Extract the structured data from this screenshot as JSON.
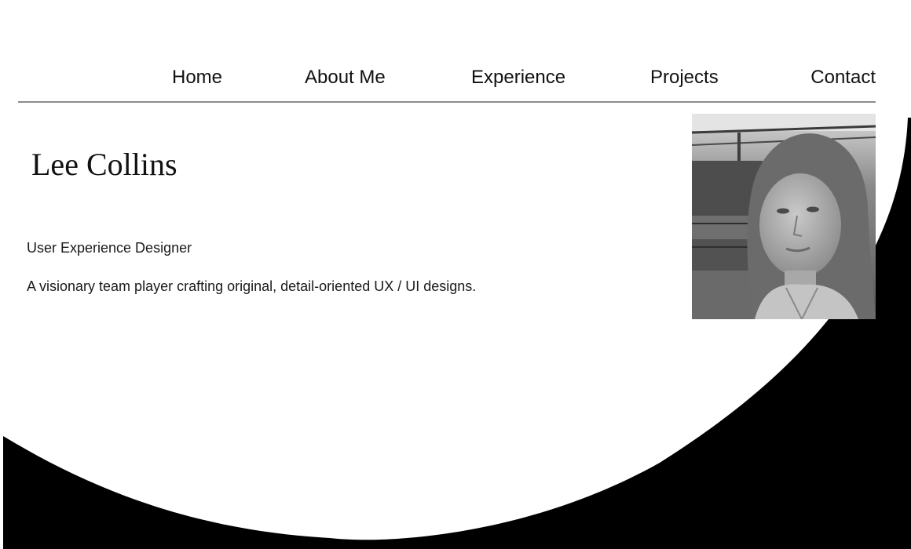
{
  "nav": {
    "items": [
      {
        "label": "Home"
      },
      {
        "label": "About Me"
      },
      {
        "label": "Experience"
      },
      {
        "label": "Projects"
      },
      {
        "label": "Contact"
      }
    ]
  },
  "hero": {
    "name": "Lee Collins",
    "role": "User Experience Designer",
    "tagline": "A visionary team player crafting original, detail-oriented UX / UI designs."
  },
  "colors": {
    "background": "#ffffff",
    "accent_shape": "#000000",
    "text": "#111111",
    "divider": "#8c8c8c"
  }
}
